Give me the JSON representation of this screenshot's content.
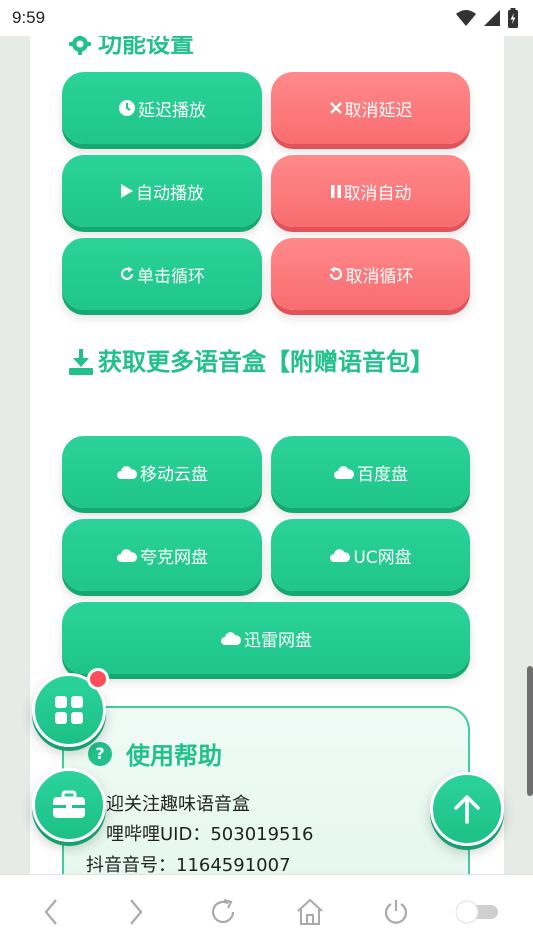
{
  "status_bar": {
    "time": "9:59"
  },
  "function_section": {
    "title": "功能设置",
    "buttons": [
      {
        "label": "延迟播放",
        "icon": "clock-icon",
        "color": "green"
      },
      {
        "label": "取消延迟",
        "icon": "close-icon",
        "color": "red"
      },
      {
        "label": "自动播放",
        "icon": "play-icon",
        "color": "green"
      },
      {
        "label": "取消自动",
        "icon": "pause-icon",
        "color": "red"
      },
      {
        "label": "单击循环",
        "icon": "redo-icon",
        "color": "green"
      },
      {
        "label": "取消循环",
        "icon": "undo-icon",
        "color": "red"
      }
    ]
  },
  "download_section": {
    "title": "获取更多语音盒【附赠语音包】",
    "buttons": [
      {
        "label": "移动云盘",
        "icon": "cloud-icon"
      },
      {
        "label": "百度盘",
        "icon": "cloud-icon"
      },
      {
        "label": "夸克网盘",
        "icon": "cloud-icon"
      },
      {
        "label": "UC网盘",
        "icon": "cloud-icon"
      },
      {
        "label": "迅雷网盘",
        "icon": "cloud-icon"
      }
    ]
  },
  "help_section": {
    "title": "使用帮助",
    "lines": [
      "迎关注趣味语音盒",
      "哩哔哩UID：503019516",
      "抖音音号：1164591007"
    ]
  },
  "colors": {
    "accent_green": "#22c08b",
    "button_green": "#24cc91",
    "button_red": "#fc7b7e",
    "badge_red": "#ff4d5a"
  }
}
